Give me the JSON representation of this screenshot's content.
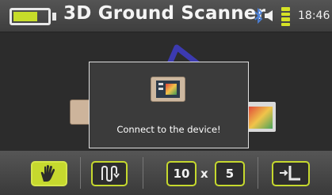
{
  "header": {
    "title": "3D Ground Scanner",
    "battery_level": 0.72,
    "time": "18:46",
    "icons": [
      "battery-icon",
      "bluetooth-icon",
      "speaker-icon",
      "signal-icon"
    ]
  },
  "dialog": {
    "message": "Connect to the device!",
    "icon": "device-tablet-icon"
  },
  "toolbar": {
    "buttons": [
      "hand-icon",
      "path-pattern-icon",
      "grid-corner-icon"
    ],
    "grid_x": "10",
    "times": "x",
    "grid_y": "5"
  },
  "colors": {
    "accent": "#c6d92e",
    "background": "#2c2c2c",
    "bar": "#4a4a4a"
  }
}
